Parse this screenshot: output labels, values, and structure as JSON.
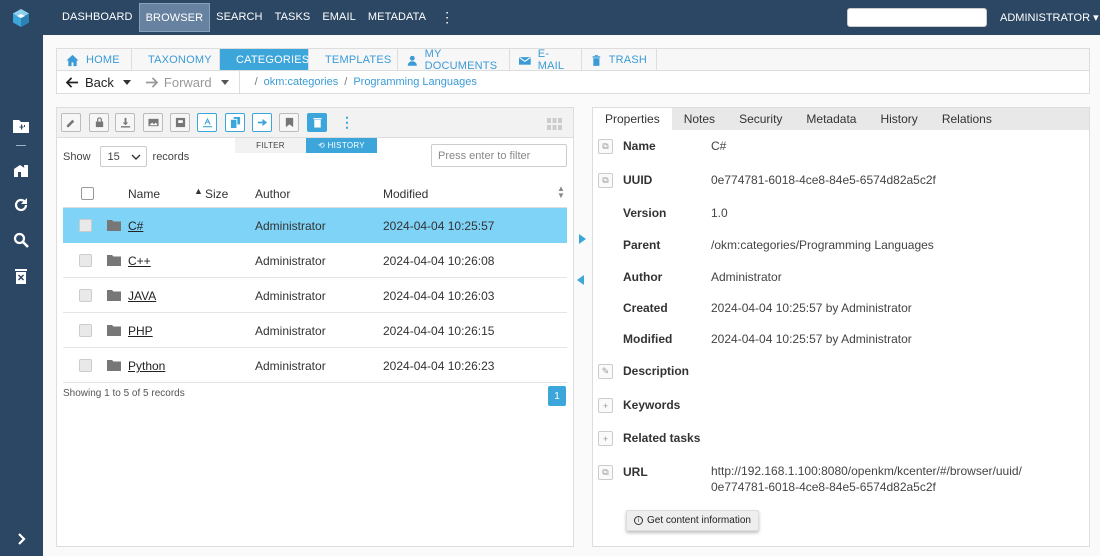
{
  "topnav": {
    "items": [
      "DASHBOARD",
      "BROWSER",
      "SEARCH",
      "TASKS",
      "EMAIL",
      "METADATA"
    ],
    "user": "ADMINISTRATOR",
    "search_value": ""
  },
  "tabs": [
    {
      "label": "HOME",
      "icon": "home-icon"
    },
    {
      "label": "TAXONOMY",
      "icon": "taxonomy-icon"
    },
    {
      "label": "CATEGORIES",
      "icon": "categories-icon"
    },
    {
      "label": "TEMPLATES",
      "icon": "templates-icon"
    },
    {
      "label": "MY DOCUMENTS",
      "icon": "user-icon"
    },
    {
      "label": "E-MAIL",
      "icon": "mail-icon"
    },
    {
      "label": "TRASH",
      "icon": "trash-icon"
    }
  ],
  "nav": {
    "back": "Back",
    "forward": "Forward",
    "crumbs": [
      "okm:categories",
      "Programming Languages"
    ]
  },
  "list": {
    "filter_tab": "FILTER",
    "history_tab": "HISTORY",
    "show_label": "Show",
    "show_value": "15",
    "records_label": "records",
    "filter_placeholder": "Press enter to filter",
    "columns": {
      "name": "Name",
      "size": "Size",
      "author": "Author",
      "modified": "Modified"
    },
    "rows": [
      {
        "name": "C#",
        "author": "Administrator",
        "modified": "2024-04-04 10:25:57",
        "selected": true
      },
      {
        "name": "C++",
        "author": "Administrator",
        "modified": "2024-04-04 10:26:08",
        "selected": false
      },
      {
        "name": "JAVA",
        "author": "Administrator",
        "modified": "2024-04-04 10:26:03",
        "selected": false
      },
      {
        "name": "PHP",
        "author": "Administrator",
        "modified": "2024-04-04 10:26:15",
        "selected": false
      },
      {
        "name": "Python",
        "author": "Administrator",
        "modified": "2024-04-04 10:26:23",
        "selected": false
      }
    ],
    "showing": "Showing 1 to 5 of 5 records",
    "page": "1"
  },
  "props": {
    "tabs": [
      "Properties",
      "Notes",
      "Security",
      "Metadata",
      "History",
      "Relations"
    ],
    "fields": [
      {
        "label": "Name",
        "value": "C#"
      },
      {
        "label": "UUID",
        "value": "0e774781-6018-4ce8-84e5-6574d82a5c2f"
      },
      {
        "label": "Version",
        "value": "1.0"
      },
      {
        "label": "Parent",
        "value": "/okm:categories/Programming Languages"
      },
      {
        "label": "Author",
        "value": "Administrator"
      },
      {
        "label": "Created",
        "value": "2024-04-04 10:25:57 by Administrator"
      },
      {
        "label": "Modified",
        "value": "2024-04-04 10:25:57 by Administrator"
      },
      {
        "label": "Description",
        "value": ""
      },
      {
        "label": "Keywords",
        "value": ""
      },
      {
        "label": "Related tasks",
        "value": ""
      },
      {
        "label": "URL",
        "value": "http://192.168.1.100:8080/openkm/kcenter/#/browser/uuid/",
        "value2": "0e774781-6018-4ce8-84e5-6574d82a5c2f"
      }
    ],
    "get_content_button": "Get content information"
  },
  "colors": {
    "accent": "#3ca6db",
    "navbar": "#2c4763",
    "selected_row": "#7fd3f7"
  }
}
